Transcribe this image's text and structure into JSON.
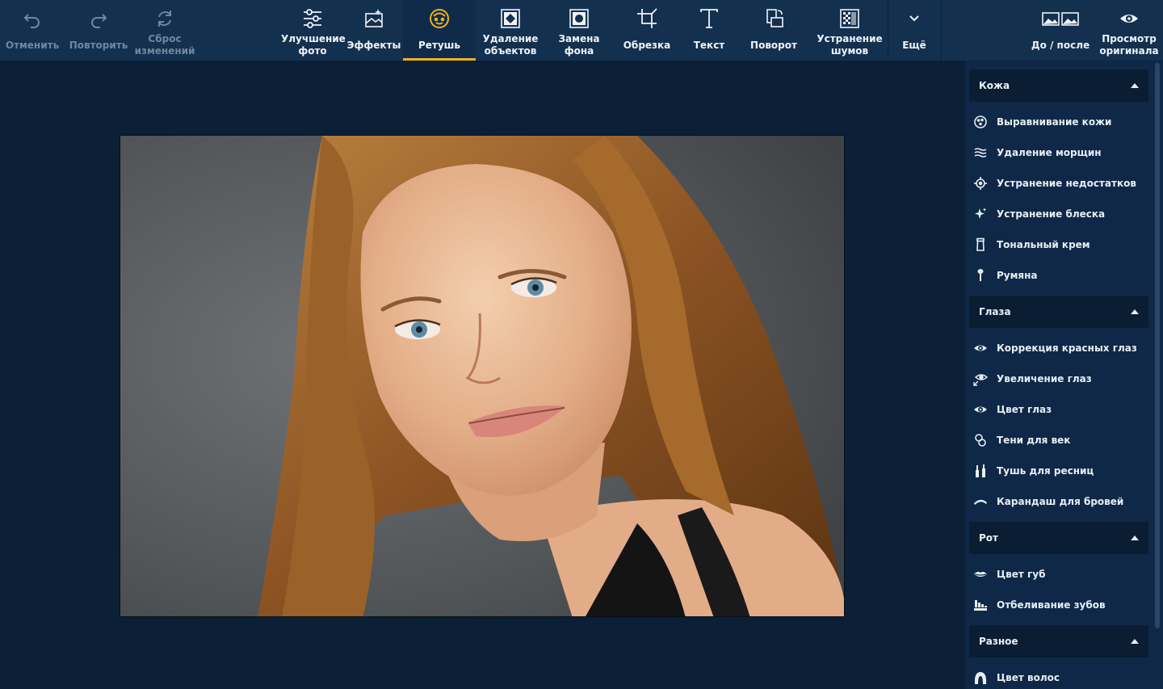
{
  "toolbar": {
    "undo": "Отменить",
    "redo": "Повторить",
    "reset": "Сброс\nизменений",
    "enhance": "Улучшение\nфото",
    "effects": "Эффекты",
    "retouch": "Ретушь",
    "remove_objects": "Удаление\nобъектов",
    "replace_bg": "Замена\nфона",
    "crop": "Обрезка",
    "text": "Текст",
    "rotate": "Поворот",
    "denoise": "Устранение\nшумов",
    "more": "Ещё",
    "before_after": "До / после",
    "view_original": "Просмотр\nоригинала"
  },
  "panel": {
    "sections": [
      {
        "title": "Кожа",
        "items": [
          {
            "label": "Выравнивание кожи",
            "icon": "skin-smoothing-icon"
          },
          {
            "label": "Удаление морщин",
            "icon": "wrinkle-removal-icon"
          },
          {
            "label": "Устранение недостатков",
            "icon": "blemish-removal-icon"
          },
          {
            "label": "Устранение блеска",
            "icon": "shine-removal-icon"
          },
          {
            "label": "Тональный крем",
            "icon": "foundation-icon"
          },
          {
            "label": "Румяна",
            "icon": "blush-brush-icon"
          }
        ]
      },
      {
        "title": "Глаза",
        "items": [
          {
            "label": "Коррекция красных глаз",
            "icon": "red-eye-icon"
          },
          {
            "label": "Увеличение глаз",
            "icon": "eye-enlarge-icon"
          },
          {
            "label": "Цвет глаз",
            "icon": "eye-color-icon"
          },
          {
            "label": "Тени для век",
            "icon": "eyeshadow-icon"
          },
          {
            "label": "Тушь для ресниц",
            "icon": "mascara-icon"
          },
          {
            "label": "Карандаш для бровей",
            "icon": "eyebrow-pencil-icon"
          }
        ]
      },
      {
        "title": "Рот",
        "items": [
          {
            "label": "Цвет губ",
            "icon": "lips-icon"
          },
          {
            "label": "Отбеливание зубов",
            "icon": "teeth-whitening-icon"
          }
        ]
      },
      {
        "title": "Разное",
        "items": [
          {
            "label": "Цвет волос",
            "icon": "hair-color-icon"
          }
        ]
      }
    ]
  },
  "colors": {
    "toolbar_bg": "#13304f",
    "workspace_bg": "#0b1f36",
    "panel_bg": "#0f2847",
    "section_header_bg": "#0b1d33",
    "active_accent": "#f2b21b"
  }
}
